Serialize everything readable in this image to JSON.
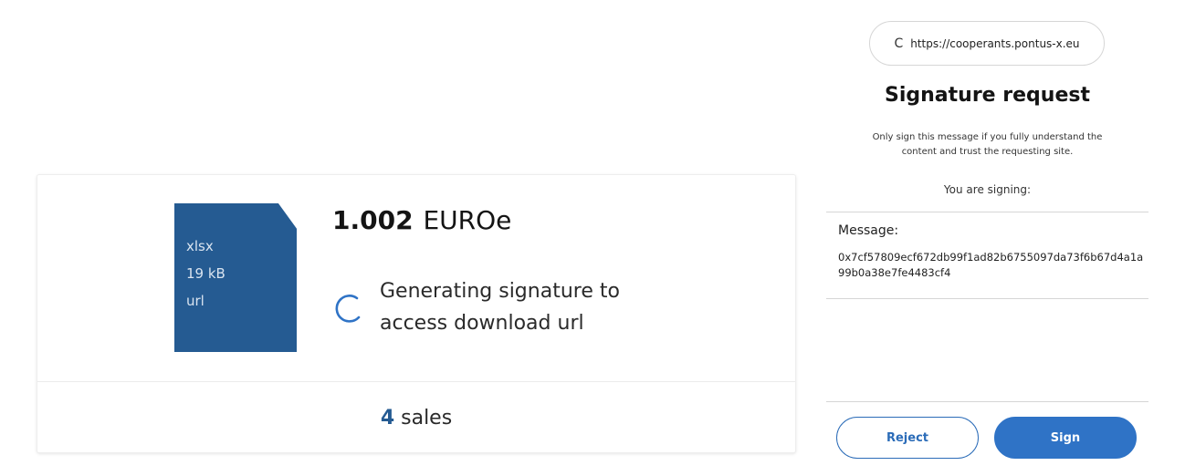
{
  "asset": {
    "file": {
      "type": "xlsx",
      "size": "19 kB",
      "access": "url"
    },
    "price": {
      "amount": "1.002",
      "currency": "EUROe"
    },
    "status": {
      "line1": "Generating signature to",
      "line2": "access download url"
    },
    "sales": {
      "count": "4",
      "label": "sales"
    },
    "colors": {
      "file_icon": "#255b92",
      "accent": "#255b92"
    }
  },
  "wallet": {
    "origin": {
      "avatar": "C",
      "url": "https://cooperants.pontus-x.eu"
    },
    "title": "Signature request",
    "warning": "Only sign this message if you fully understand the content and trust the requesting site.",
    "signing_label": "You are signing:",
    "message": {
      "label": "Message:",
      "value": "0x7cf57809ecf672db99f1ad82b6755097da73f6b67d4a1a99b0a38e7fe4483cf4"
    },
    "buttons": {
      "reject": "Reject",
      "sign": "Sign"
    },
    "colors": {
      "primary": "#2f73c6"
    }
  }
}
